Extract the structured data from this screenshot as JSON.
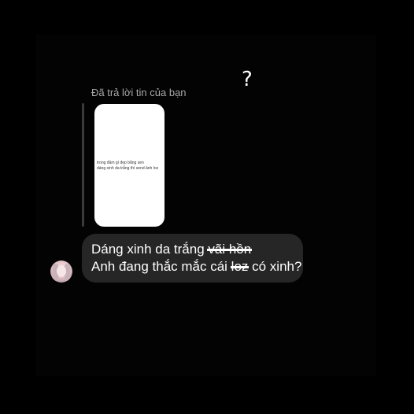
{
  "conversation": {
    "reaction_text": "?",
    "reply_caption": "Đã trả lời tin của bạn",
    "story_preview": {
      "lines": [
        "trong đầm gì đẹp bằng sen",
        "dáng xinh da trắng thì send ảnh loz"
      ]
    },
    "message": {
      "line1_prefix": "Dáng xinh da trắng ",
      "line1_struck": "vãi hồn",
      "line2_prefix": "Anh đang thắc mắc cái ",
      "line2_struck": "loz",
      "line2_suffix": " có xinh?"
    },
    "avatar_icon": "user-avatar-icon"
  },
  "colors": {
    "background": "#000000",
    "bubble": "#262626",
    "caption": "#a8a8a8",
    "story_card": "#ffffff"
  }
}
